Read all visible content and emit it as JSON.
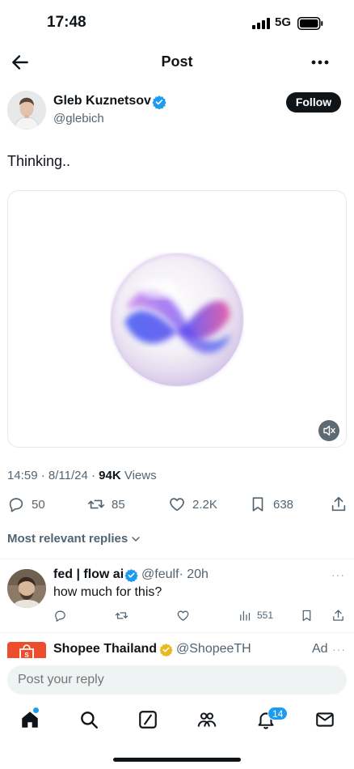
{
  "status_bar": {
    "time": "17:48",
    "network": "5G"
  },
  "nav": {
    "title": "Post"
  },
  "author": {
    "name": "Gleb Kuznetsov",
    "handle": "@glebich",
    "follow_label": "Follow"
  },
  "post": {
    "text": "Thinking..",
    "time": "14:59 · 8/11/24 · ",
    "views_count": "94K",
    "views_label": " Views"
  },
  "actions": {
    "replies": "50",
    "reposts": "85",
    "likes": "2.2K",
    "bookmarks": "638"
  },
  "replies_sort": "Most relevant replies",
  "reply": {
    "name": "fed | flow ai",
    "handle": "@feulf",
    "age": "· 20h",
    "text": "how much for this?",
    "views": "551",
    "more": "···"
  },
  "ad": {
    "name": "Shopee Thailand",
    "handle": "@ShopeeTH",
    "badge": "Ad",
    "more": "···"
  },
  "composer": {
    "placeholder": "Post your reply"
  },
  "tabs": {
    "notifications_count": "14"
  },
  "colors": {
    "accent": "#1d9bf0",
    "text": "#0f1419",
    "muted": "#536471",
    "verified_gold": "#e8b923",
    "shopee": "#ee4d2d"
  },
  "icons": {
    "signal": "signal-bars-icon",
    "battery": "battery-icon",
    "back": "arrow-left-icon",
    "more": "more-horizontal-icon",
    "verified": "verified-badge-icon",
    "mute": "speaker-muted-icon",
    "reply": "comment-icon",
    "repost": "repost-icon",
    "like": "heart-icon",
    "bookmark": "bookmark-icon",
    "share": "share-icon",
    "views": "bar-chart-icon",
    "home": "home-icon",
    "search": "search-icon",
    "grok": "grok-icon",
    "communities": "people-icon",
    "notifications": "bell-icon",
    "messages": "envelope-icon"
  }
}
